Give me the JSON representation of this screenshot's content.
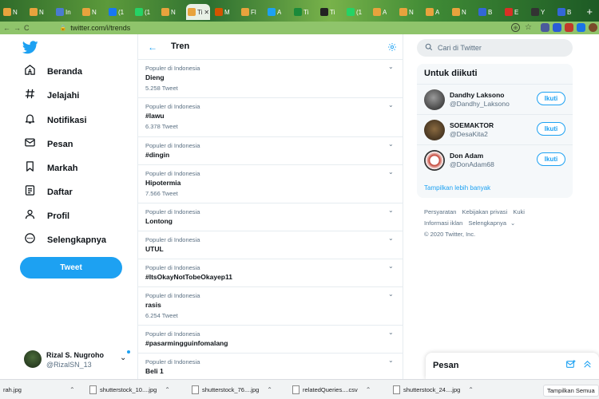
{
  "browser": {
    "tabs": [
      {
        "label": "N",
        "color": "#e8a33d"
      },
      {
        "label": "N",
        "color": "#e8a33d"
      },
      {
        "label": "In",
        "color": "#4a7bd0"
      },
      {
        "label": "N",
        "color": "#e8a33d"
      },
      {
        "label": "(1",
        "color": "#1877f2"
      },
      {
        "label": "(1",
        "color": "#25d366"
      },
      {
        "label": "N",
        "color": "#e8a33d"
      },
      {
        "label": "Ti",
        "color": "#e8a33d"
      },
      {
        "label": "M",
        "color": "#d35400"
      },
      {
        "label": "Fl",
        "color": "#e8a33d"
      },
      {
        "label": "A",
        "color": "#1da1f2"
      },
      {
        "label": "Ti",
        "color": "#1b8a3a"
      },
      {
        "label": "Ti",
        "color": "#222222"
      },
      {
        "label": "(1",
        "color": "#25d366"
      },
      {
        "label": "A",
        "color": "#e8a33d"
      },
      {
        "label": "N",
        "color": "#e8a33d"
      },
      {
        "label": "A",
        "color": "#e8a33d"
      },
      {
        "label": "N",
        "color": "#e8a33d"
      },
      {
        "label": "B",
        "color": "#3367d6"
      },
      {
        "label": "E",
        "color": "#d93025"
      },
      {
        "label": "Y",
        "color": "#333333"
      },
      {
        "label": "B",
        "color": "#3367d6"
      }
    ],
    "active_tab_close": "✕",
    "new_tab": "+",
    "url": "twitter.com/i/trends",
    "back": "←",
    "forward": "→",
    "reload": "C"
  },
  "nav": {
    "items": [
      {
        "label": "Beranda",
        "icon": "home-icon"
      },
      {
        "label": "Jelajahi",
        "icon": "hashtag-icon"
      },
      {
        "label": "Notifikasi",
        "icon": "bell-icon"
      },
      {
        "label": "Pesan",
        "icon": "mail-icon"
      },
      {
        "label": "Markah",
        "icon": "bookmark-icon"
      },
      {
        "label": "Daftar",
        "icon": "list-icon"
      },
      {
        "label": "Profil",
        "icon": "person-icon"
      },
      {
        "label": "Selengkapnya",
        "icon": "more-icon"
      }
    ],
    "tweet_button": "Tweet",
    "account": {
      "name": "Rizal S. Nugroho",
      "handle": "@RizalSN_13"
    }
  },
  "trends": {
    "title": "Tren",
    "items": [
      {
        "category": "Populer di Indonesia",
        "name": "Dieng",
        "count": "5.258 Tweet"
      },
      {
        "category": "Populer di Indonesia",
        "name": "#lawu",
        "count": "6.378 Tweet"
      },
      {
        "category": "Populer di Indonesia",
        "name": "#dingin",
        "count": ""
      },
      {
        "category": "Populer di Indonesia",
        "name": "Hipotermia",
        "count": "7.566 Tweet"
      },
      {
        "category": "Populer di Indonesia",
        "name": "Lontong",
        "count": ""
      },
      {
        "category": "Populer di Indonesia",
        "name": "UTUL",
        "count": ""
      },
      {
        "category": "Populer di Indonesia",
        "name": "#ItsOkayNotTobeOkayep11",
        "count": ""
      },
      {
        "category": "Populer di Indonesia",
        "name": "rasis",
        "count": "6.254 Tweet"
      },
      {
        "category": "Populer di Indonesia",
        "name": "#pasarmingguinfomalang",
        "count": ""
      },
      {
        "category": "Populer di Indonesia",
        "name": "Beli 1",
        "count": ""
      }
    ]
  },
  "right": {
    "search_placeholder": "Cari di Twitter",
    "follow_title": "Untuk diikuti",
    "follow_button": "Ikuti",
    "follow": [
      {
        "name": "Dandhy Laksono",
        "handle": "@Dandhy_Laksono"
      },
      {
        "name": "SOEMAKTOR",
        "handle": "@DesaKita2"
      },
      {
        "name": "Don Adam",
        "handle": "@DonAdam68"
      }
    ],
    "show_more": "Tampilkan lebih banyak",
    "footer_links": [
      "Persyaratan",
      "Kebijakan privasi",
      "Kuki",
      "Informasi iklan",
      "Selengkapnya"
    ],
    "copyright": "© 2020 Twitter, Inc.",
    "messages_title": "Pesan"
  },
  "downloads": {
    "items": [
      "rah.jpg",
      "shutterstock_10....jpg",
      "shutterstock_76....jpg",
      "relatedQueries....csv",
      "shutterstock_24....jpg"
    ],
    "show_all": "Tampilkan Semua"
  },
  "colors": {
    "accent": "#1da1f2",
    "text": "#0f1419",
    "muted": "#5b7083"
  }
}
